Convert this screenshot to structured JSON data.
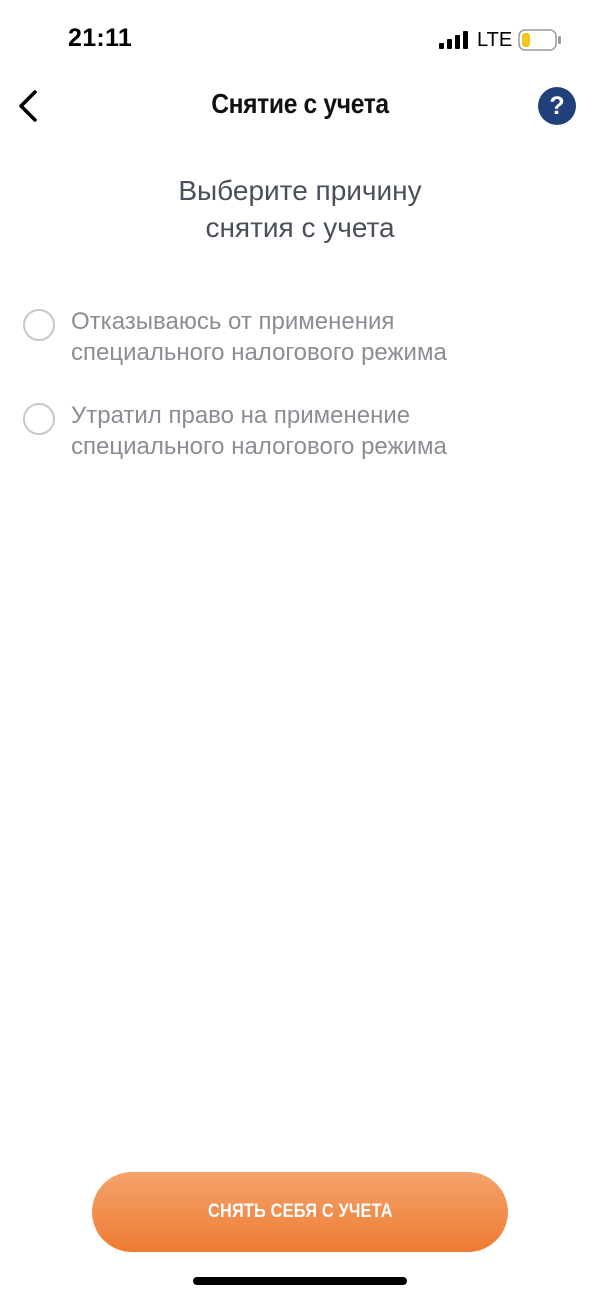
{
  "status_bar": {
    "time": "21:11",
    "network": "LTE",
    "signal_icon": "signal-bars-icon",
    "battery_icon": "battery-low-icon",
    "battery_fill_fraction": 0.25,
    "battery_color": "#f5c518"
  },
  "nav": {
    "title": "Снятие с учета",
    "back_icon": "chevron-left-icon",
    "help_label": "?",
    "help_color": "#21407a"
  },
  "heading": {
    "line1": "Выберите причину",
    "line2": "снятия с учета"
  },
  "options": [
    {
      "line1": "Отказываюсь от применения",
      "line2": "специального налогового режима",
      "selected": false
    },
    {
      "line1": "Утратил право на применение",
      "line2": "специального налогового режима",
      "selected": false
    }
  ],
  "submit": {
    "label": "СНЯТЬ СЕБЯ С УЧЕТА",
    "color_top": "#f4a36b",
    "color_bottom": "#ef7b33"
  }
}
